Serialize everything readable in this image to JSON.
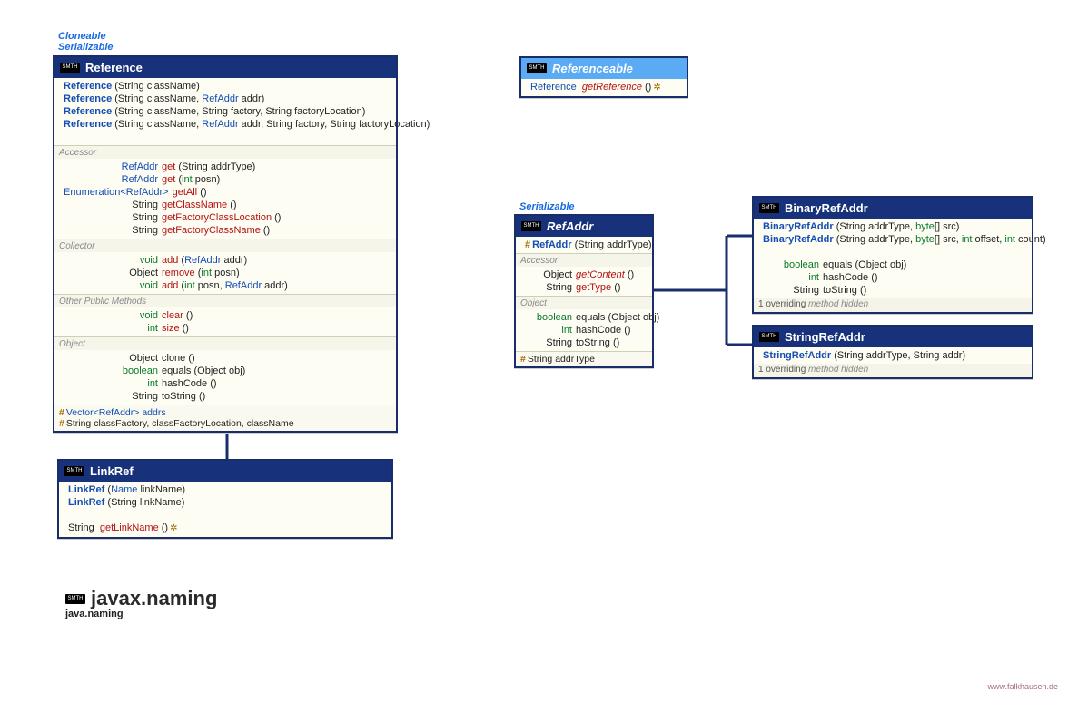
{
  "interfaces": {
    "cloneable": "Cloneable",
    "serializable": "Serializable",
    "serializable2": "Serializable"
  },
  "reference": {
    "title": "Reference",
    "ctors": [
      {
        "name": "Reference",
        "sig": "(String className)"
      },
      {
        "name": "Reference",
        "sig_pre": "(String className, ",
        "reftype": "RefAddr",
        "sig_post": " addr)"
      },
      {
        "name": "Reference",
        "sig": "(String className, String factory, String factoryLocation)"
      },
      {
        "name": "Reference",
        "sig_pre": "(String className, ",
        "reftype": "RefAddr",
        "sig_post": " addr, String factory, String factoryLocation)"
      }
    ],
    "sec_accessor": "Accessor",
    "acc": [
      {
        "ret": "RefAddr",
        "name": "get",
        "args": "(String addrType)"
      },
      {
        "ret": "RefAddr",
        "name": "get",
        "args_pre": "(",
        "args_prim": "int",
        "args_post": " posn)"
      },
      {
        "ret_pre": "Enumeration<",
        "ret_mid": "RefAddr",
        "ret_post": ">",
        "name": "getAll",
        "args": "()"
      },
      {
        "ret": "String",
        "name": "getClassName",
        "args": "()"
      },
      {
        "ret": "String",
        "name": "getFactoryClassLocation",
        "args": "()"
      },
      {
        "ret": "String",
        "name": "getFactoryClassName",
        "args": "()"
      }
    ],
    "sec_collector": "Collector",
    "col": [
      {
        "ret": "void",
        "name": "add",
        "args_pre": "(",
        "reftype": "RefAddr",
        "args_post": " addr)"
      },
      {
        "ret": "Object",
        "name": "remove",
        "args_pre": "(",
        "args_prim": "int",
        "args_post": " posn)"
      },
      {
        "ret": "void",
        "name": "add",
        "args_pre": "(",
        "args_prim": "int",
        "args_mid": " posn, ",
        "reftype": "RefAddr",
        "args_post": " addr)"
      }
    ],
    "sec_other": "Other Public Methods",
    "oth": [
      {
        "ret": "void",
        "name": "clear",
        "args": "()"
      },
      {
        "ret": "int",
        "name": "size",
        "args": "()"
      }
    ],
    "sec_object": "Object",
    "obj": [
      {
        "ret": "Object",
        "name": "clone",
        "args": "()"
      },
      {
        "ret": "boolean",
        "name": "equals",
        "args": "(Object obj)"
      },
      {
        "ret": "int",
        "name": "hashCode",
        "args": "()"
      },
      {
        "ret": "String",
        "name": "toString",
        "args": "()"
      }
    ],
    "field1_pre": "Vector<",
    "field1_mid": "RefAddr",
    "field1_post": "> addrs",
    "field2": "String classFactory, classFactoryLocation, className"
  },
  "linkref": {
    "title": "LinkRef",
    "ctors": [
      {
        "name": "LinkRef",
        "args_pre": "(",
        "reftype": "Name",
        "args_post": " linkName)"
      },
      {
        "name": "LinkRef",
        "args": "(String linkName)"
      }
    ],
    "m": {
      "ret": "String",
      "name": "getLinkName",
      "args": "()"
    }
  },
  "referenceable": {
    "title": "Referenceable",
    "m": {
      "ret": "Reference",
      "name": "getReference",
      "args": "()"
    }
  },
  "refaddr": {
    "title": "RefAddr",
    "ctor": {
      "name": "RefAddr",
      "args": "(String addrType)"
    },
    "sec_accessor": "Accessor",
    "acc": [
      {
        "ret": "Object",
        "name": "getContent",
        "args": "()",
        "abstract": true
      },
      {
        "ret": "String",
        "name": "getType",
        "args": "()"
      }
    ],
    "sec_object": "Object",
    "obj": [
      {
        "ret": "boolean",
        "name": "equals",
        "args": "(Object obj)"
      },
      {
        "ret": "int",
        "name": "hashCode",
        "args": "()"
      },
      {
        "ret": "String",
        "name": "toString",
        "args": "()"
      }
    ],
    "field": "String addrType"
  },
  "binaryrefaddr": {
    "title": "BinaryRefAddr",
    "ctors": [
      {
        "name": "BinaryRefAddr",
        "args_pre": "(String addrType, ",
        "prim": "byte",
        "args_post": "[] src)"
      },
      {
        "name": "BinaryRefAddr",
        "args_pre": "(String addrType, ",
        "prim": "byte",
        "args_mid": "[] src, ",
        "prim2": "int",
        "args_mid2": " offset, ",
        "prim3": "int",
        "args_post": " count)"
      }
    ],
    "obj": [
      {
        "ret": "boolean",
        "name": "equals",
        "args": "(Object obj)"
      },
      {
        "ret": "int",
        "name": "hashCode",
        "args": "()"
      },
      {
        "ret": "String",
        "name": "toString",
        "args": "()"
      }
    ],
    "hidden": "1 overriding method hidden"
  },
  "stringrefaddr": {
    "title": "StringRefAddr",
    "ctor": {
      "name": "StringRefAddr",
      "args": "(String addrType, String addr)"
    },
    "hidden": "1 overriding method hidden"
  },
  "pkg": {
    "name": "javax.naming",
    "module": "java.naming"
  },
  "since_label": "SMTH",
  "footer": "www.falkhausen.de"
}
